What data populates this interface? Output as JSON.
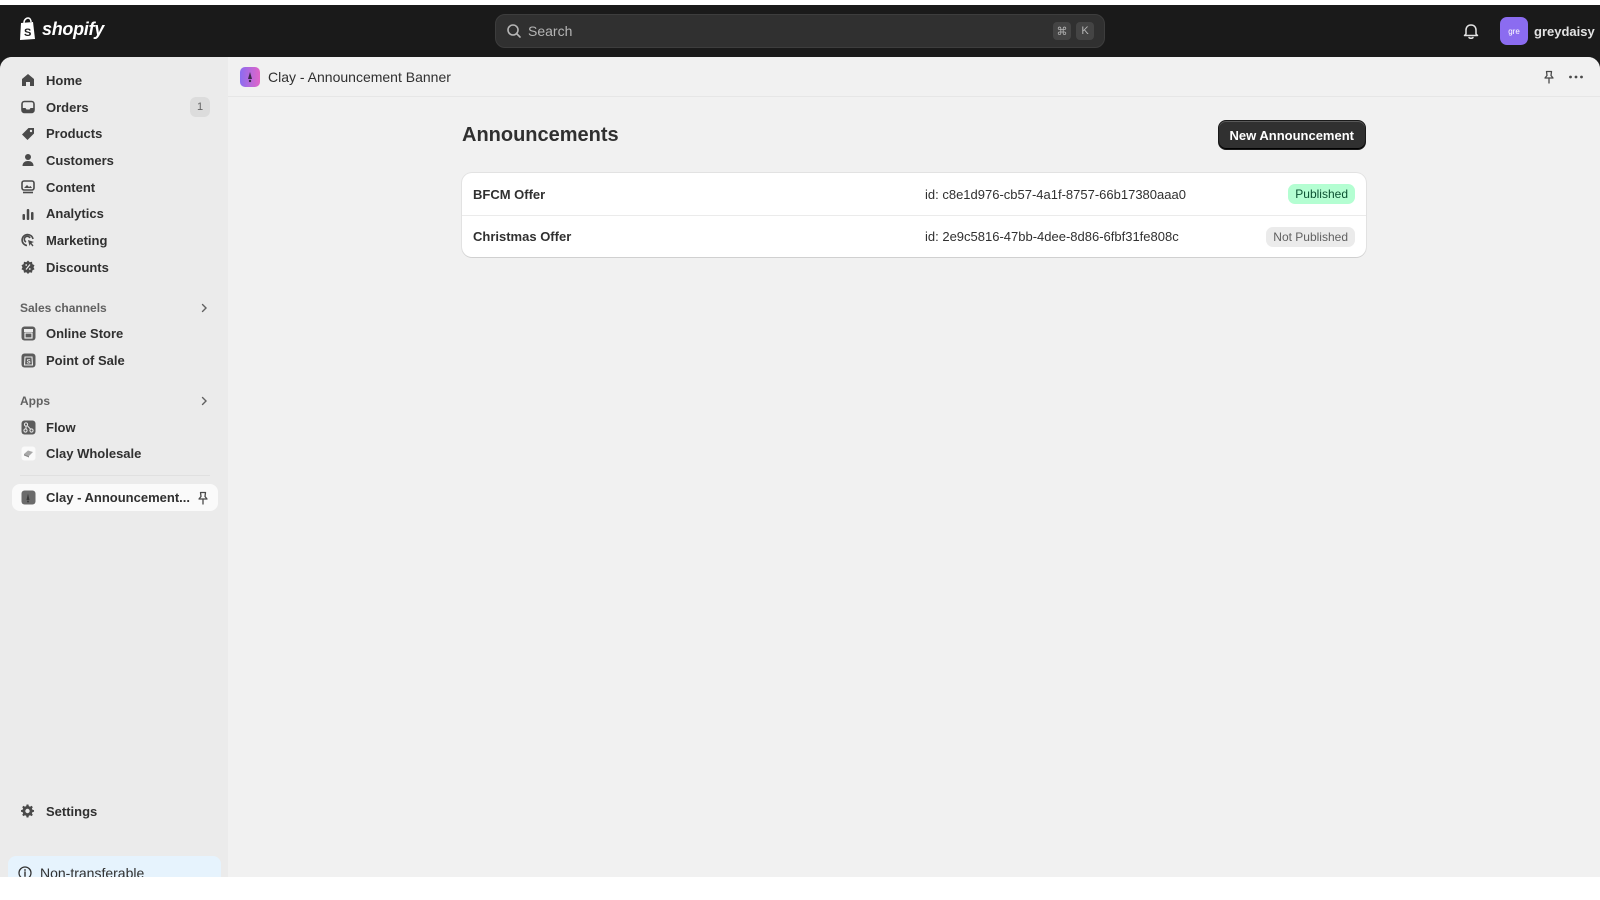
{
  "topbar": {
    "brand": "shopify",
    "search_placeholder": "Search",
    "shortcut_keys": [
      "⌘",
      "K"
    ],
    "user": {
      "initials": "gre",
      "name": "greydaisy",
      "avatar_color": "#8b6cf0"
    }
  },
  "sidebar": {
    "main_items": [
      {
        "label": "Home",
        "icon": "home-icon"
      },
      {
        "label": "Orders",
        "icon": "orders-icon",
        "badge": "1"
      },
      {
        "label": "Products",
        "icon": "tag-icon"
      },
      {
        "label": "Customers",
        "icon": "person-icon"
      },
      {
        "label": "Content",
        "icon": "content-icon"
      },
      {
        "label": "Analytics",
        "icon": "bar-chart-icon"
      },
      {
        "label": "Marketing",
        "icon": "target-icon"
      },
      {
        "label": "Discounts",
        "icon": "discount-icon"
      }
    ],
    "sales_channels": {
      "heading": "Sales channels",
      "items": [
        {
          "label": "Online Store",
          "icon": "store-icon"
        },
        {
          "label": "Point of Sale",
          "icon": "pos-icon"
        }
      ]
    },
    "apps": {
      "heading": "Apps",
      "items": [
        {
          "label": "Flow",
          "icon": "flow-icon"
        },
        {
          "label": "Clay Wholesale",
          "icon": "clay-wholesale-icon"
        }
      ]
    },
    "pinned_app": {
      "label": "Clay - Announcement...",
      "icon": "clay-announcement-icon"
    },
    "settings_label": "Settings",
    "footer_notice": "Non-transferable"
  },
  "app_header": {
    "title": "Clay - Announcement Banner",
    "logo_gradient": [
      "#8b6cf0",
      "#e165c8"
    ]
  },
  "page": {
    "title": "Announcements",
    "primary_action": "New Announcement",
    "announcements": [
      {
        "name": "BFCM Offer",
        "id": "id: c8e1d976-cb57-4a1f-8757-66b17380aaa0",
        "status": "Published",
        "status_color": "#b4fed2"
      },
      {
        "name": "Christmas Offer",
        "id": "id: 2e9c5816-47bb-4dee-8d86-6fbf31fe808c",
        "status": "Not Published",
        "status_color": "#ebebeb"
      }
    ]
  }
}
